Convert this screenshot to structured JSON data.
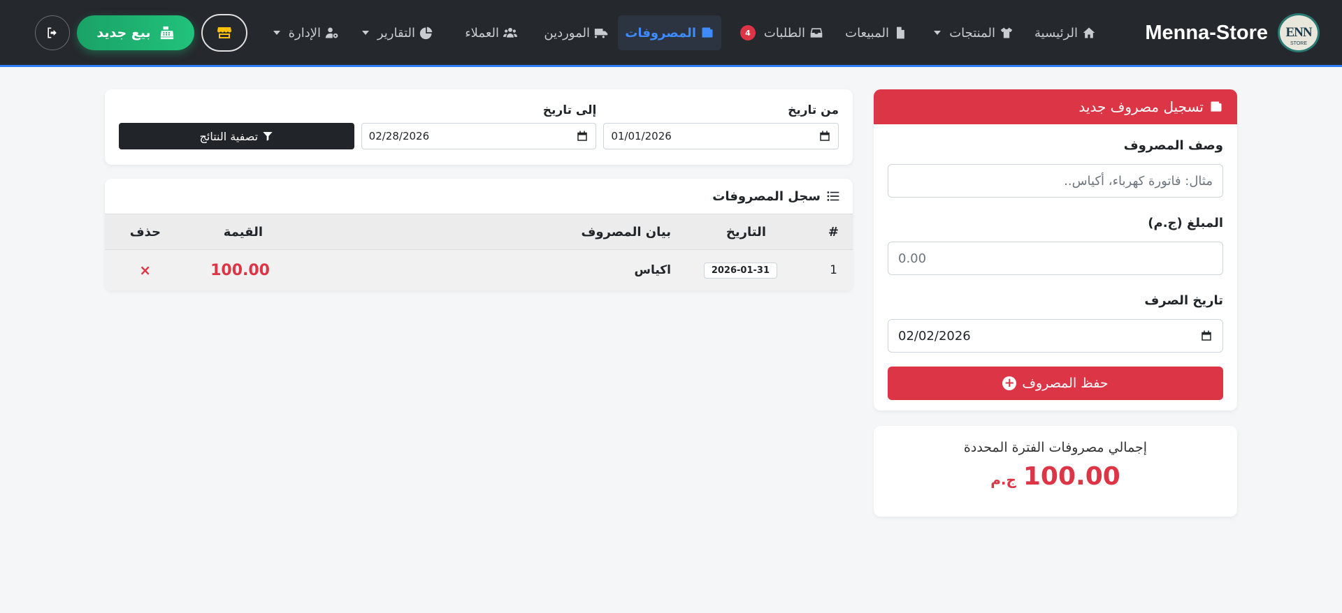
{
  "navbar": {
    "brand_name": "Menna-Store",
    "logo_text": "ENN",
    "logo_sub": "STORE",
    "items": [
      {
        "label": "الرئيسية",
        "icon": "home-icon"
      },
      {
        "label": "المنتجات",
        "icon": "shirt-icon",
        "dropdown": true
      },
      {
        "label": "المبيعات",
        "icon": "document-icon"
      },
      {
        "label": "الطلبات",
        "icon": "inbox-icon",
        "badge": "4"
      },
      {
        "label": "المصروفات",
        "icon": "wallet-icon",
        "active": true
      },
      {
        "label": "الموردين",
        "icon": "truck-icon"
      },
      {
        "label": "العملاء",
        "icon": "users-icon"
      },
      {
        "label": "التقارير",
        "icon": "pie-chart-icon",
        "dropdown": true
      },
      {
        "label": "الإدارة",
        "icon": "user-gear-icon",
        "dropdown": true
      }
    ],
    "new_sale_label": "بيع جديد",
    "accent_color": "#2d7ff9"
  },
  "expense_form": {
    "title": "تسجيل مصروف جديد",
    "description_label": "وصف المصروف",
    "description_placeholder": "مثال: فاتورة كهرباء، أكياس..",
    "amount_label": "المبلغ (ج.م)",
    "amount_placeholder": "0.00",
    "date_label": "تاريخ الصرف",
    "date_value": "02/02/2026",
    "save_label": "حفظ المصروف",
    "header_color": "#dc3545"
  },
  "total": {
    "label": "إجمالي مصروفات الفترة المحددة",
    "value": "100.00",
    "currency": "ج.م"
  },
  "filter": {
    "from_label": "من تاريخ",
    "from_value": "01/01/2026",
    "to_label": "إلى تاريخ",
    "to_value": "02/28/2026",
    "button_label": "تصفية النتائج"
  },
  "log": {
    "title": "سجل المصروفات",
    "columns": {
      "index": "#",
      "date": "التاريخ",
      "description": "بيان المصروف",
      "amount": "القيمة",
      "delete": "حذف"
    },
    "rows": [
      {
        "index": "1",
        "date": "2026-01-31",
        "description": "اكياس",
        "amount": "100.00",
        "delete": "×"
      }
    ]
  }
}
